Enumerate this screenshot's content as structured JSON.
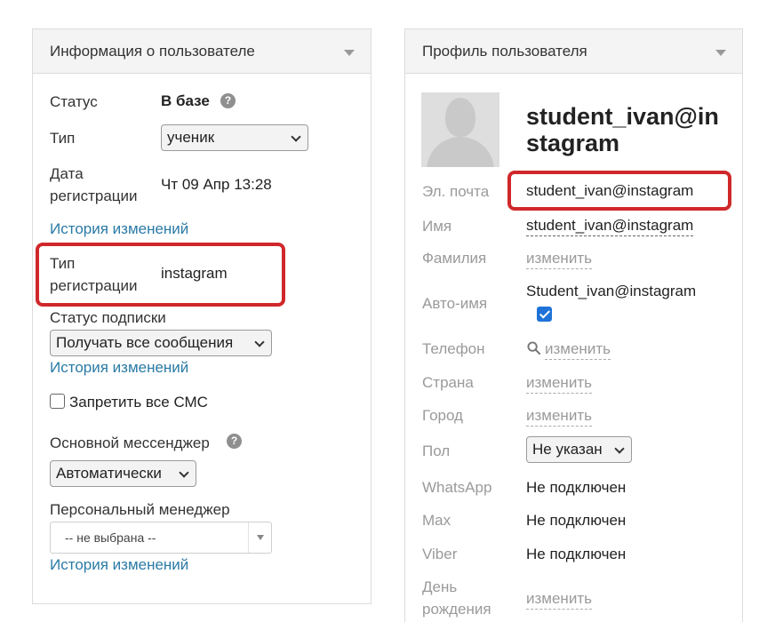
{
  "user_info": {
    "title": "Информация о пользователе",
    "status_label": "Статус",
    "status_value": "В базе",
    "type_label": "Тип",
    "type_value": "ученик",
    "reg_date_label_1": "Дата",
    "reg_date_label_2": "регистрации",
    "reg_date_value": "Чт 09 Апр 13:28",
    "history_link": "История изменений",
    "reg_type_label_1": "Тип",
    "reg_type_label_2": "регистрации",
    "reg_type_value": "instagram",
    "subscription_label": "Статус подписки",
    "subscription_value": "Получать все сообщения",
    "sms_label": "Запретить все СМС",
    "messenger_label": "Основной мессенджер",
    "messenger_value": "Автоматически",
    "manager_label": "Персональный менеджер",
    "manager_value": "-- не выбрана --"
  },
  "profile": {
    "title": "Профиль пользователя",
    "name_display": "student_ivan@instagram",
    "email_label": "Эл. почта",
    "email_value": "student_ivan@instagram",
    "first_name_label": "Имя",
    "first_name_value": "student_ivan@instagram",
    "last_name_label": "Фамилия",
    "change_link": "изменить",
    "auto_name_label": "Авто-имя",
    "auto_name_value": "Student_ivan@instagram",
    "phone_label": "Телефон",
    "country_label": "Страна",
    "city_label": "Город",
    "gender_label": "Пол",
    "gender_value": "Не указан",
    "whatsapp_label": "WhatsApp",
    "whatsapp_value": "Не подключен",
    "max_label": "Max",
    "max_value": "Не подключен",
    "viber_label": "Viber",
    "viber_value": "Не подключен",
    "birthday_label_1": "День",
    "birthday_label_2": "рождения"
  },
  "colors": {
    "highlight": "#d0282a",
    "link": "#2a7aa6",
    "checkbox": "#1f73d8"
  }
}
